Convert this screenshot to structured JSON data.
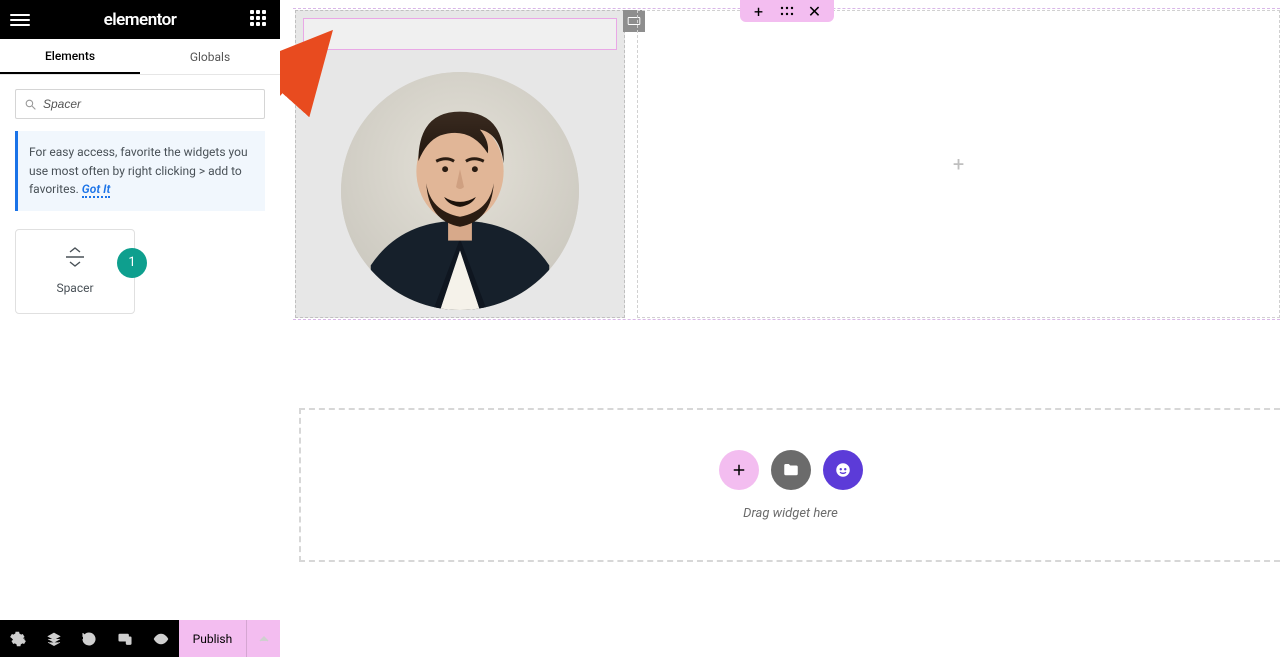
{
  "header": {
    "brand": "elementor"
  },
  "tabs": {
    "elements": "Elements",
    "globals": "Globals"
  },
  "search": {
    "placeholder": "Spacer",
    "value": "Spacer"
  },
  "tip": {
    "text": "For easy access, favorite the widgets you use most often by right clicking > add to favorites. ",
    "link": "Got It"
  },
  "widget": {
    "name": "Spacer"
  },
  "step_badge": "1",
  "footer": {
    "publish": "Publish"
  },
  "dropzone": {
    "hint": "Drag widget here"
  },
  "icons": {
    "plus": "+",
    "close": "✕",
    "chevron_left": "‹",
    "chevron_up": "⌃"
  },
  "colors": {
    "accent_pink": "#f3bdf0",
    "accent_teal": "#0e9f8e",
    "accent_purple": "#5c3bd8",
    "arrow": "#e84b1f"
  }
}
